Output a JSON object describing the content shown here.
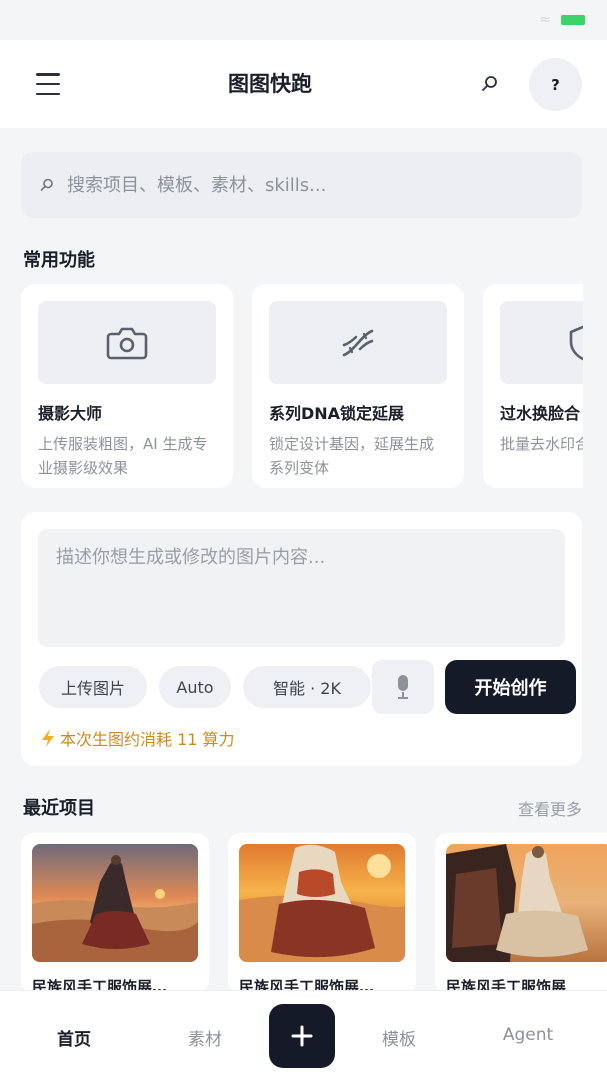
{
  "app": {
    "title": "图图快跑",
    "help_label": "?"
  },
  "search": {
    "placeholder": "搜索项目、模板、素材、skills..."
  },
  "features": {
    "title": "常用功能",
    "items": [
      {
        "name": "摄影大师",
        "desc": "上传服装粗图，AI 生成专业摄影级效果",
        "icon": "camera-icon"
      },
      {
        "name": "系列DNA锁定延展",
        "desc": "锁定设计基因，延展生成系列变体",
        "icon": "dna-icon"
      },
      {
        "name": "过水换脸合",
        "desc": "批量去水印合规处理",
        "icon": "shield-icon"
      }
    ]
  },
  "composer": {
    "placeholder": "描述你想生成或修改的图片内容...",
    "upload_label": "上传图片",
    "ratio_label": "Auto",
    "quality_label": "智能 · 2K",
    "create_label": "开始创作",
    "cost_note": "本次生图约消耗 11 算力"
  },
  "recent": {
    "title": "最近项目",
    "see_more": "查看更多",
    "items": [
      {
        "name": "民族风手工服饰展…"
      },
      {
        "name": "民族风手工服饰展…"
      },
      {
        "name": "民族风手工服饰展"
      }
    ]
  },
  "nav": {
    "items": [
      {
        "label": "首页"
      },
      {
        "label": "素材"
      },
      {
        "label": "模板"
      },
      {
        "label": "Agent"
      }
    ]
  },
  "colors": {
    "accent_dark": "#141a28",
    "cost_orange": "#d08a1a",
    "battery_green": "#3dd26a"
  }
}
